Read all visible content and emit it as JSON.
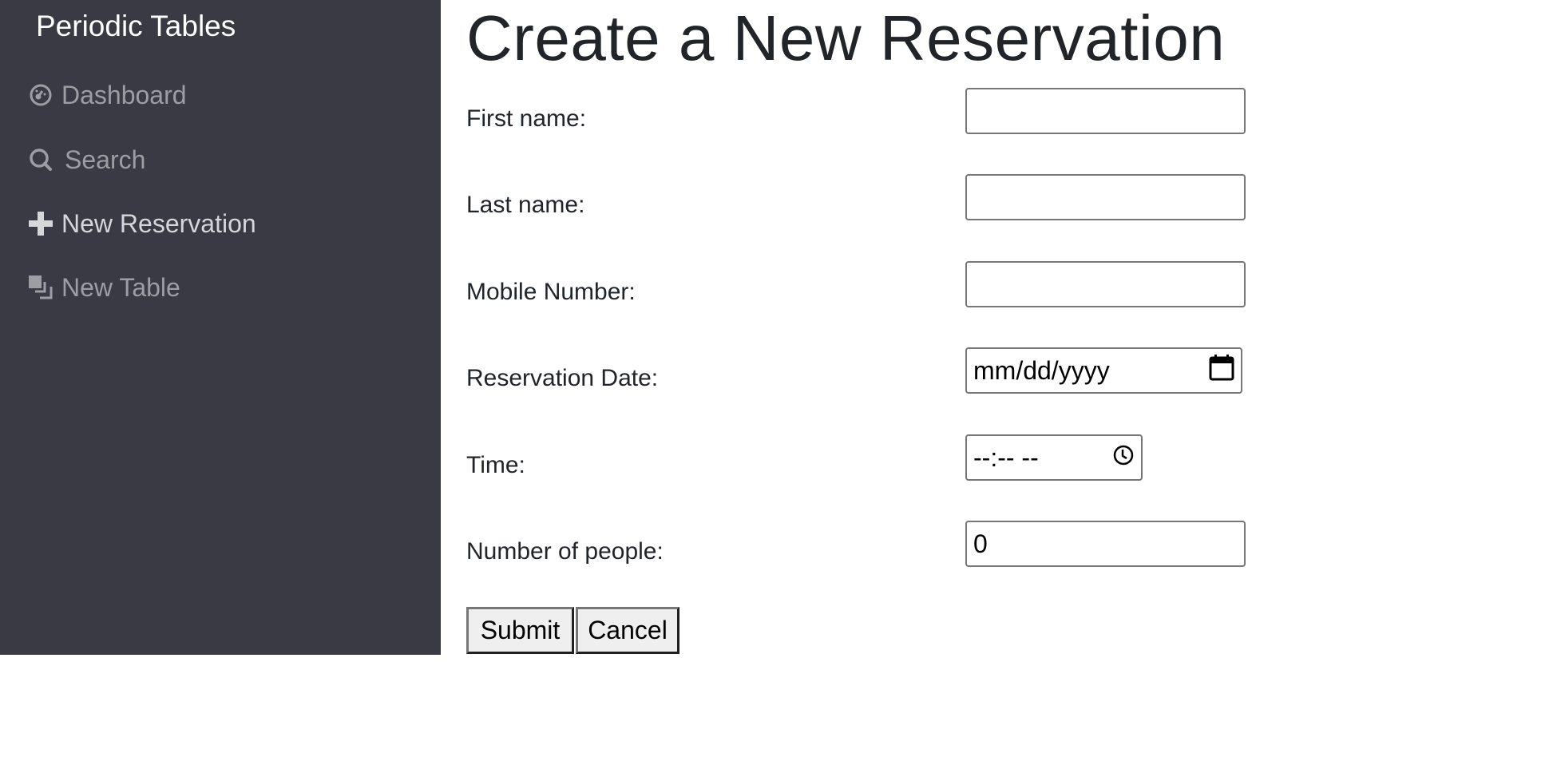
{
  "sidebar": {
    "brand": "Periodic Tables",
    "items": [
      {
        "label": "Dashboard",
        "icon": "dashboard-icon"
      },
      {
        "label": "Search",
        "icon": "search-icon"
      },
      {
        "label": "New Reservation",
        "icon": "plus-icon"
      },
      {
        "label": "New Table",
        "icon": "layers-icon"
      }
    ]
  },
  "main": {
    "title": "Create a New Reservation",
    "form": {
      "first_name": {
        "label": "First name:",
        "value": ""
      },
      "last_name": {
        "label": "Last name:",
        "value": ""
      },
      "mobile": {
        "label": "Mobile Number:",
        "value": ""
      },
      "date": {
        "label": "Reservation Date:",
        "placeholder": "mm/dd/yyyy"
      },
      "time": {
        "label": "Time:",
        "placeholder": "--:-- --"
      },
      "people": {
        "label": "Number of people:",
        "value": "0"
      }
    },
    "submit_label": "Submit",
    "cancel_label": "Cancel"
  }
}
